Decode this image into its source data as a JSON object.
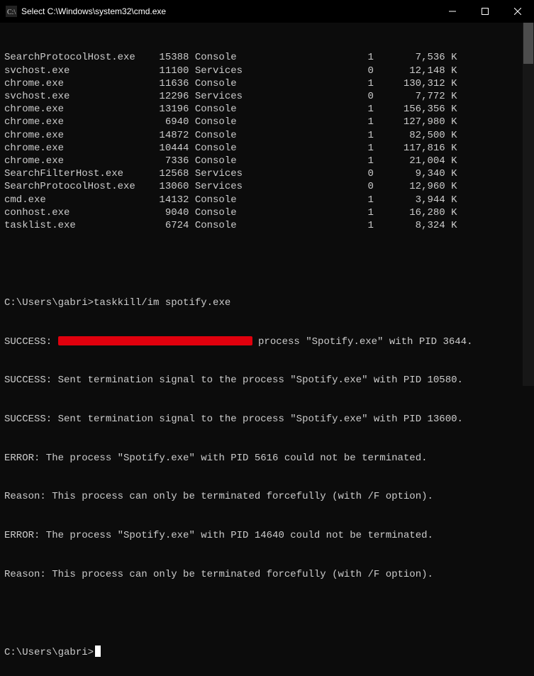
{
  "window": {
    "title": "Select C:\\Windows\\system32\\cmd.exe",
    "icon": "cmd-icon",
    "controls": {
      "min": "—",
      "max": "▢",
      "close": "✕"
    }
  },
  "tasklist": [
    {
      "name": "SearchProtocolHost.exe",
      "pid": "15388",
      "session": "Console",
      "sessno": "1",
      "mem": "7,536",
      "unit": "K"
    },
    {
      "name": "svchost.exe",
      "pid": "11100",
      "session": "Services",
      "sessno": "0",
      "mem": "12,148",
      "unit": "K"
    },
    {
      "name": "chrome.exe",
      "pid": "11636",
      "session": "Console",
      "sessno": "1",
      "mem": "130,312",
      "unit": "K"
    },
    {
      "name": "svchost.exe",
      "pid": "12296",
      "session": "Services",
      "sessno": "0",
      "mem": "7,772",
      "unit": "K"
    },
    {
      "name": "chrome.exe",
      "pid": "13196",
      "session": "Console",
      "sessno": "1",
      "mem": "156,356",
      "unit": "K"
    },
    {
      "name": "chrome.exe",
      "pid": "6940",
      "session": "Console",
      "sessno": "1",
      "mem": "127,980",
      "unit": "K"
    },
    {
      "name": "chrome.exe",
      "pid": "14872",
      "session": "Console",
      "sessno": "1",
      "mem": "82,500",
      "unit": "K"
    },
    {
      "name": "chrome.exe",
      "pid": "10444",
      "session": "Console",
      "sessno": "1",
      "mem": "117,816",
      "unit": "K"
    },
    {
      "name": "chrome.exe",
      "pid": "7336",
      "session": "Console",
      "sessno": "1",
      "mem": "21,004",
      "unit": "K"
    },
    {
      "name": "SearchFilterHost.exe",
      "pid": "12568",
      "session": "Services",
      "sessno": "0",
      "mem": "9,340",
      "unit": "K"
    },
    {
      "name": "SearchProtocolHost.exe",
      "pid": "13060",
      "session": "Services",
      "sessno": "0",
      "mem": "12,960",
      "unit": "K"
    },
    {
      "name": "cmd.exe",
      "pid": "14132",
      "session": "Console",
      "sessno": "1",
      "mem": "3,944",
      "unit": "K"
    },
    {
      "name": "conhost.exe",
      "pid": "9040",
      "session": "Console",
      "sessno": "1",
      "mem": "16,280",
      "unit": "K"
    },
    {
      "name": "tasklist.exe",
      "pid": "6724",
      "session": "Console",
      "sessno": "1",
      "mem": "8,324",
      "unit": "K"
    }
  ],
  "prompt1": "C:\\Users\\gabri>",
  "command1": "taskkill/im spotify.exe",
  "output": {
    "line1_pre": "SUCCESS: ",
    "line1_post": " process \"Spotify.exe\" with PID 3644.",
    "line2": "SUCCESS: Sent termination signal to the process \"Spotify.exe\" with PID 10580.",
    "line3": "SUCCESS: Sent termination signal to the process \"Spotify.exe\" with PID 13600.",
    "line4": "ERROR: The process \"Spotify.exe\" with PID 5616 could not be terminated.",
    "line5": "Reason: This process can only be terminated forcefully (with /F option).",
    "line6": "ERROR: The process \"Spotify.exe\" with PID 14640 could not be terminated.",
    "line7": "Reason: This process can only be terminated forcefully (with /F option)."
  },
  "prompt2": "C:\\Users\\gabri>"
}
